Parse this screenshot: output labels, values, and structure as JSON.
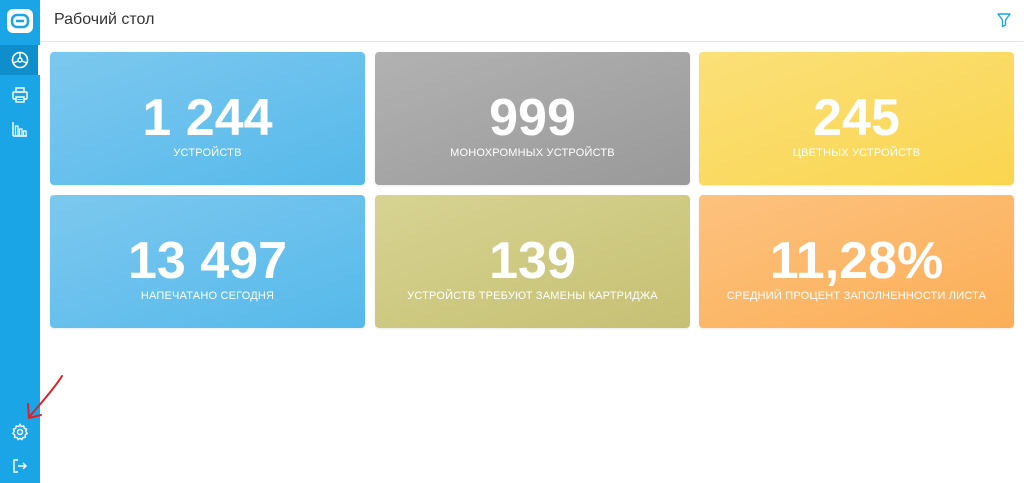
{
  "header": {
    "title": "Рабочий стол"
  },
  "sidebar": {
    "items": [
      {
        "icon": "dashboard-icon"
      },
      {
        "icon": "printer-icon"
      },
      {
        "icon": "bar-chart-icon"
      }
    ],
    "bottom": [
      {
        "icon": "gear-icon"
      },
      {
        "icon": "logout-icon"
      }
    ]
  },
  "tiles": [
    {
      "value": "1 244",
      "label": "УСТРОЙСТВ"
    },
    {
      "value": "999",
      "label": "МОНОХРОМНЫХ УСТРОЙСТВ"
    },
    {
      "value": "245",
      "label": "ЦВЕТНЫХ УСТРОЙСТВ"
    },
    {
      "value": "13 497",
      "label": "НАПЕЧАТАНО СЕГОДНЯ"
    },
    {
      "value": "139",
      "label": "УСТРОЙСТВ ТРЕБУЮТ ЗАМЕНЫ КАРТРИДЖА"
    },
    {
      "value": "11,28%",
      "label": "СРЕДНИЙ ПРОЦЕНТ ЗАПОЛНЕННОСТИ ЛИСТА"
    }
  ],
  "colors": {
    "sidebar": "#1aa6e6",
    "accent": "#1aa6e6",
    "tile_blue": "#62bdeb",
    "tile_gray": "#a6a6a6",
    "tile_yellow": "#fbd964",
    "tile_olive": "#cfca83",
    "tile_orange": "#fcb86a",
    "annotation_arrow": "#d9232a"
  }
}
